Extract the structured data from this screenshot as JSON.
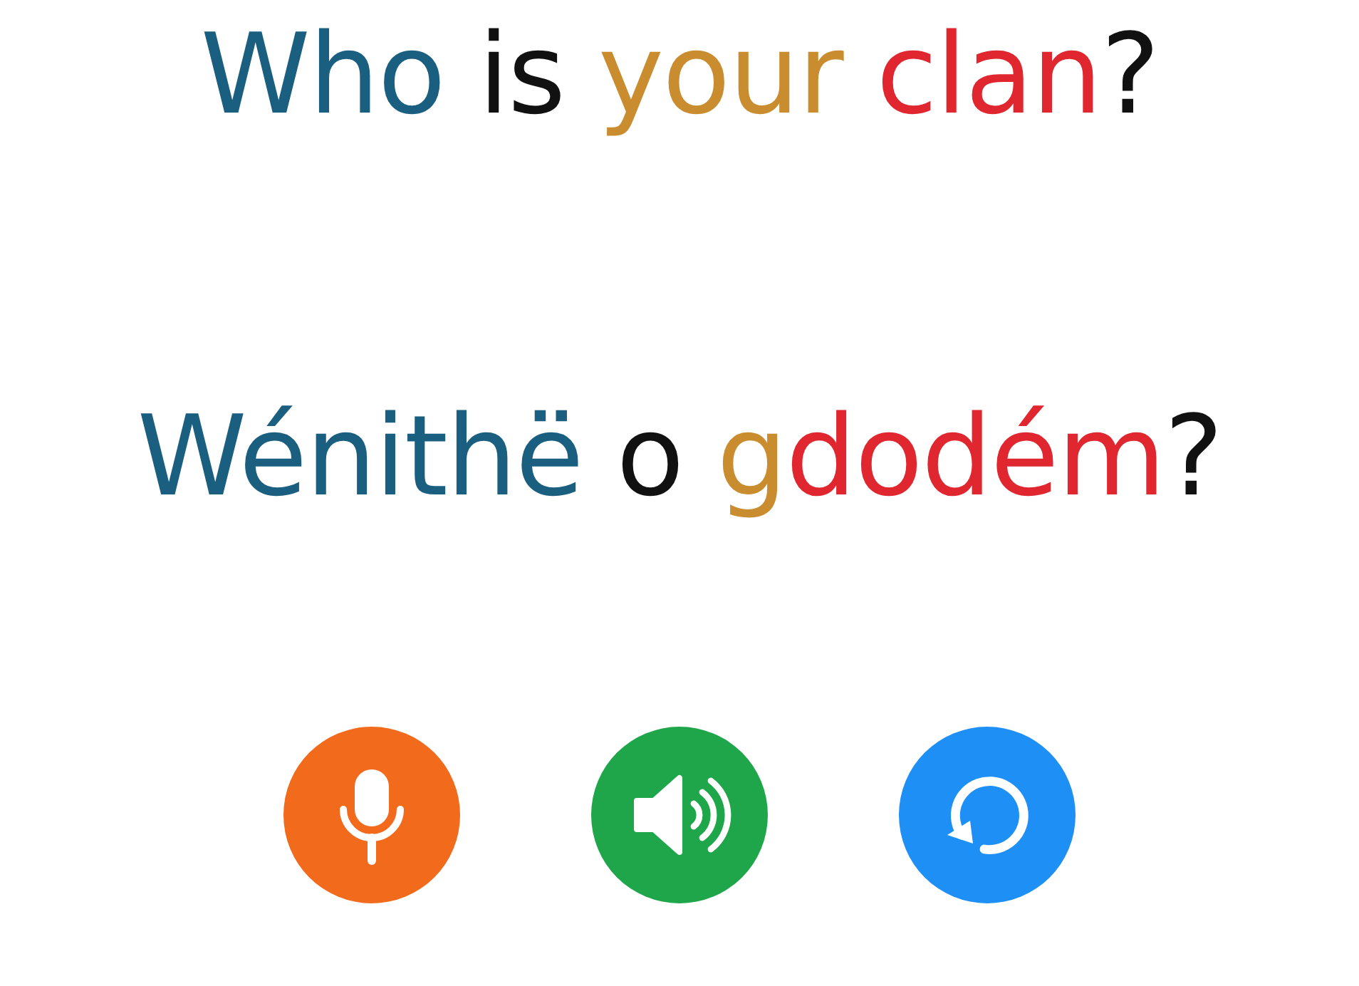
{
  "phrases": [
    {
      "segments": [
        {
          "text": "Who",
          "color": "#1b5f80"
        },
        {
          "text": " is ",
          "color": "#111111"
        },
        {
          "text": "your ",
          "color": "#c98c2e"
        },
        {
          "text": "clan",
          "color": "#e0262e"
        },
        {
          "text": "?",
          "color": "#111111"
        }
      ]
    },
    {
      "segments": [
        {
          "text": "Wénithë",
          "color": "#1b5f80"
        },
        {
          "text": " o ",
          "color": "#111111"
        },
        {
          "text": "g",
          "color": "#c98c2e"
        },
        {
          "text": "dodém",
          "color": "#e0262e"
        },
        {
          "text": "?",
          "color": "#111111"
        }
      ]
    }
  ],
  "buttons": [
    {
      "kind": "microphone",
      "color": "#f26a1b"
    },
    {
      "kind": "speaker",
      "color": "#1fa64b"
    },
    {
      "kind": "replay",
      "color": "#1e90f5"
    }
  ]
}
